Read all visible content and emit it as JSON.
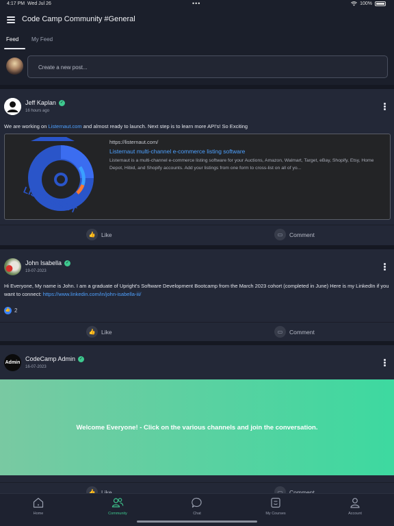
{
  "status": {
    "time": "4:17 PM",
    "date": "Wed Jul 26",
    "battery": "100%"
  },
  "app": {
    "title": "Code Camp Community #General"
  },
  "tabs": [
    {
      "label": "Feed",
      "active": true
    },
    {
      "label": "My Feed",
      "active": false
    }
  ],
  "composer": {
    "placeholder": "Create a new post..."
  },
  "posts": [
    {
      "author": "Jeff Kaplan",
      "timestamp": "16 hours ago",
      "text_before": "We are working on ",
      "link": "Listernaut.com",
      "text_after": " and almost ready to launch. Next step is to learn more API's! So Exciting",
      "preview": {
        "url": "https://listernaut.com/",
        "title": "Listernaut multi-channel e-commerce listing software",
        "description": "Listernaut is a multi-channel e-commerce listing software for your Auctions, Amazon, Walmart, Target, eBay, Shopify, Etsy, Home Depot, Hibid, and Shopify accounts. Add your listings from one form to cross-list on all of yo...",
        "logo_text": "LISTERNAUT"
      },
      "like_label": "Like",
      "comment_label": "Comment"
    },
    {
      "author": "John Isabella",
      "timestamp": "19-07-2023",
      "text_before": "Hi Everyone,  My name is John.  I am a graduate of Upright's Software Development Bootcamp from the March 2023 cohort (completed in June)  Here is my LinkedIn if you want to connect: ",
      "link": "https://www.linkedin.com/in/john-isabella-iii/",
      "reactions": "2",
      "like_label": "Like",
      "comment_label": "Comment"
    },
    {
      "author": "CodeCamp Admin",
      "avatar_text": "Admin",
      "timestamp": "16-07-2023",
      "banner_text": "Welcome Everyone! - Click on the various channels and join the conversation.",
      "like_label": "Like",
      "comment_label": "Comment"
    }
  ],
  "nav": [
    {
      "label": "Home",
      "icon": "home-icon"
    },
    {
      "label": "Community",
      "icon": "community-icon",
      "active": true
    },
    {
      "label": "Chat",
      "icon": "chat-icon"
    },
    {
      "label": "My Courses",
      "icon": "courses-icon"
    },
    {
      "label": "Account",
      "icon": "account-icon"
    }
  ],
  "colors": {
    "accent": "#3ec98f",
    "link": "#4ea1ff",
    "background": "#1b1f2b",
    "card": "#232837"
  }
}
